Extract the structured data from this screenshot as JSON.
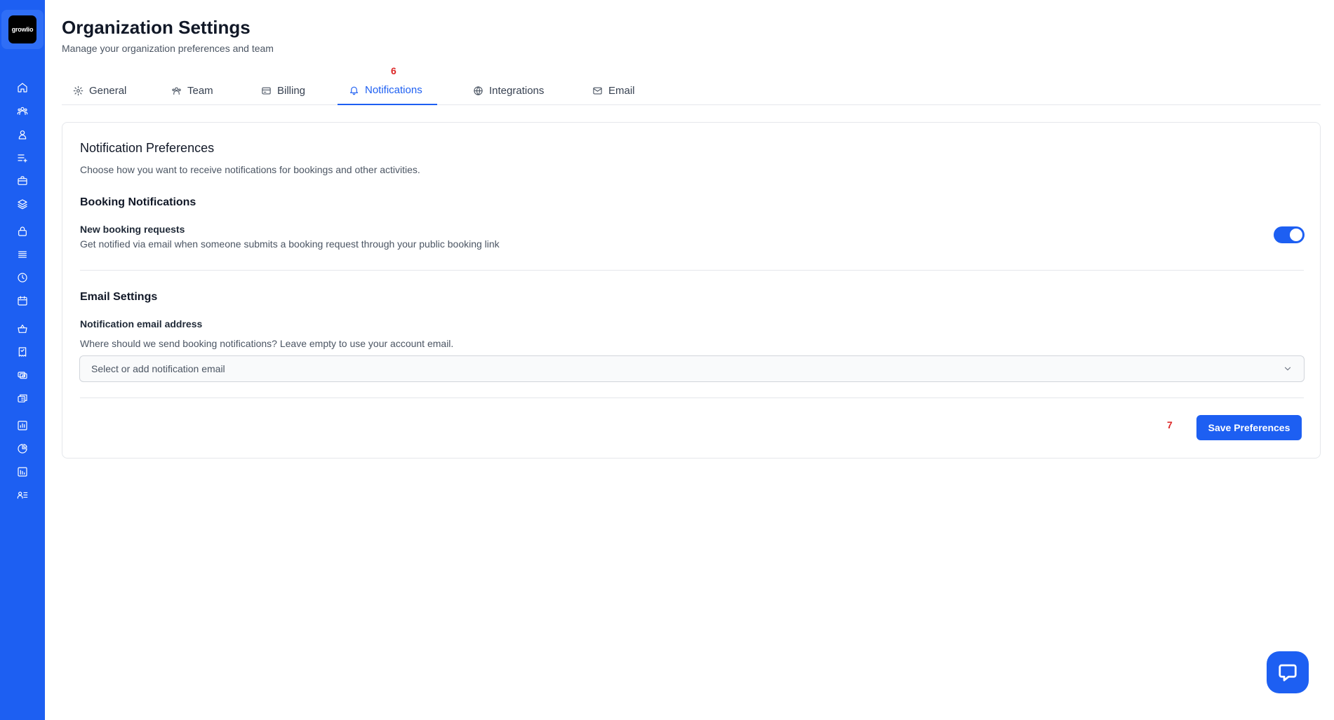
{
  "app": {
    "logo_text": "growlio"
  },
  "sidebar": {
    "icons": [
      "home-icon",
      "team-icon",
      "user-icon",
      "list-add-icon",
      "briefcase-icon",
      "layers-icon",
      "lock-icon",
      "menu-icon",
      "clock-icon",
      "calendar-icon",
      "basket-icon",
      "receipt-icon",
      "coins-icon",
      "stack-icon",
      "chart-icon",
      "pie-chart-icon",
      "bar-chart-icon",
      "user-list-icon"
    ]
  },
  "header": {
    "title": "Organization Settings",
    "subtitle": "Manage your organization preferences and team"
  },
  "tabs": [
    {
      "label": "General",
      "icon": "gear-icon",
      "active": false
    },
    {
      "label": "Team",
      "icon": "team-icon",
      "active": false
    },
    {
      "label": "Billing",
      "icon": "credit-card-icon",
      "active": false
    },
    {
      "label": "Notifications",
      "icon": "bell-icon",
      "active": true
    },
    {
      "label": "Integrations",
      "icon": "globe-icon",
      "active": false
    },
    {
      "label": "Email",
      "icon": "mail-icon",
      "active": false
    }
  ],
  "markers": {
    "tab_marker": "6",
    "save_marker": "7"
  },
  "card": {
    "title": "Notification Preferences",
    "description": "Choose how you want to receive notifications for bookings and other activities.",
    "booking": {
      "section_title": "Booking Notifications",
      "label": "New booking requests",
      "description": "Get notified via email when someone submits a booking request through your public booking link",
      "enabled": true
    },
    "email": {
      "section_title": "Email Settings",
      "label": "Notification email address",
      "description": "Where should we send booking notifications? Leave empty to use your account email.",
      "select_placeholder": "Select or add notification email"
    },
    "save_label": "Save Preferences"
  },
  "colors": {
    "accent": "#1d5ff2",
    "marker": "#dc2626"
  }
}
